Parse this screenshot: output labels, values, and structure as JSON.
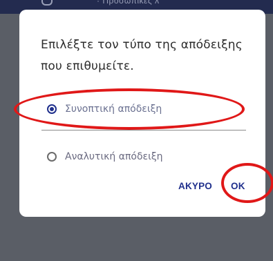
{
  "background": {
    "top_text": "· Προσωπικές λ",
    "accent_color": "#232b4f"
  },
  "dialog": {
    "title": "Επιλέξτε τον τύπο της απόδειξης που επιθυμείτε.",
    "options": [
      {
        "label": "Συνοπτική απόδειξη",
        "selected": true
      },
      {
        "label": "Αναλυτική απόδειξη",
        "selected": false
      }
    ],
    "buttons": {
      "cancel_label": "ΑΚΥΡΟ",
      "ok_label": "OK"
    }
  },
  "colors": {
    "primary": "#1f2f8c",
    "annotation": "#e01818"
  }
}
